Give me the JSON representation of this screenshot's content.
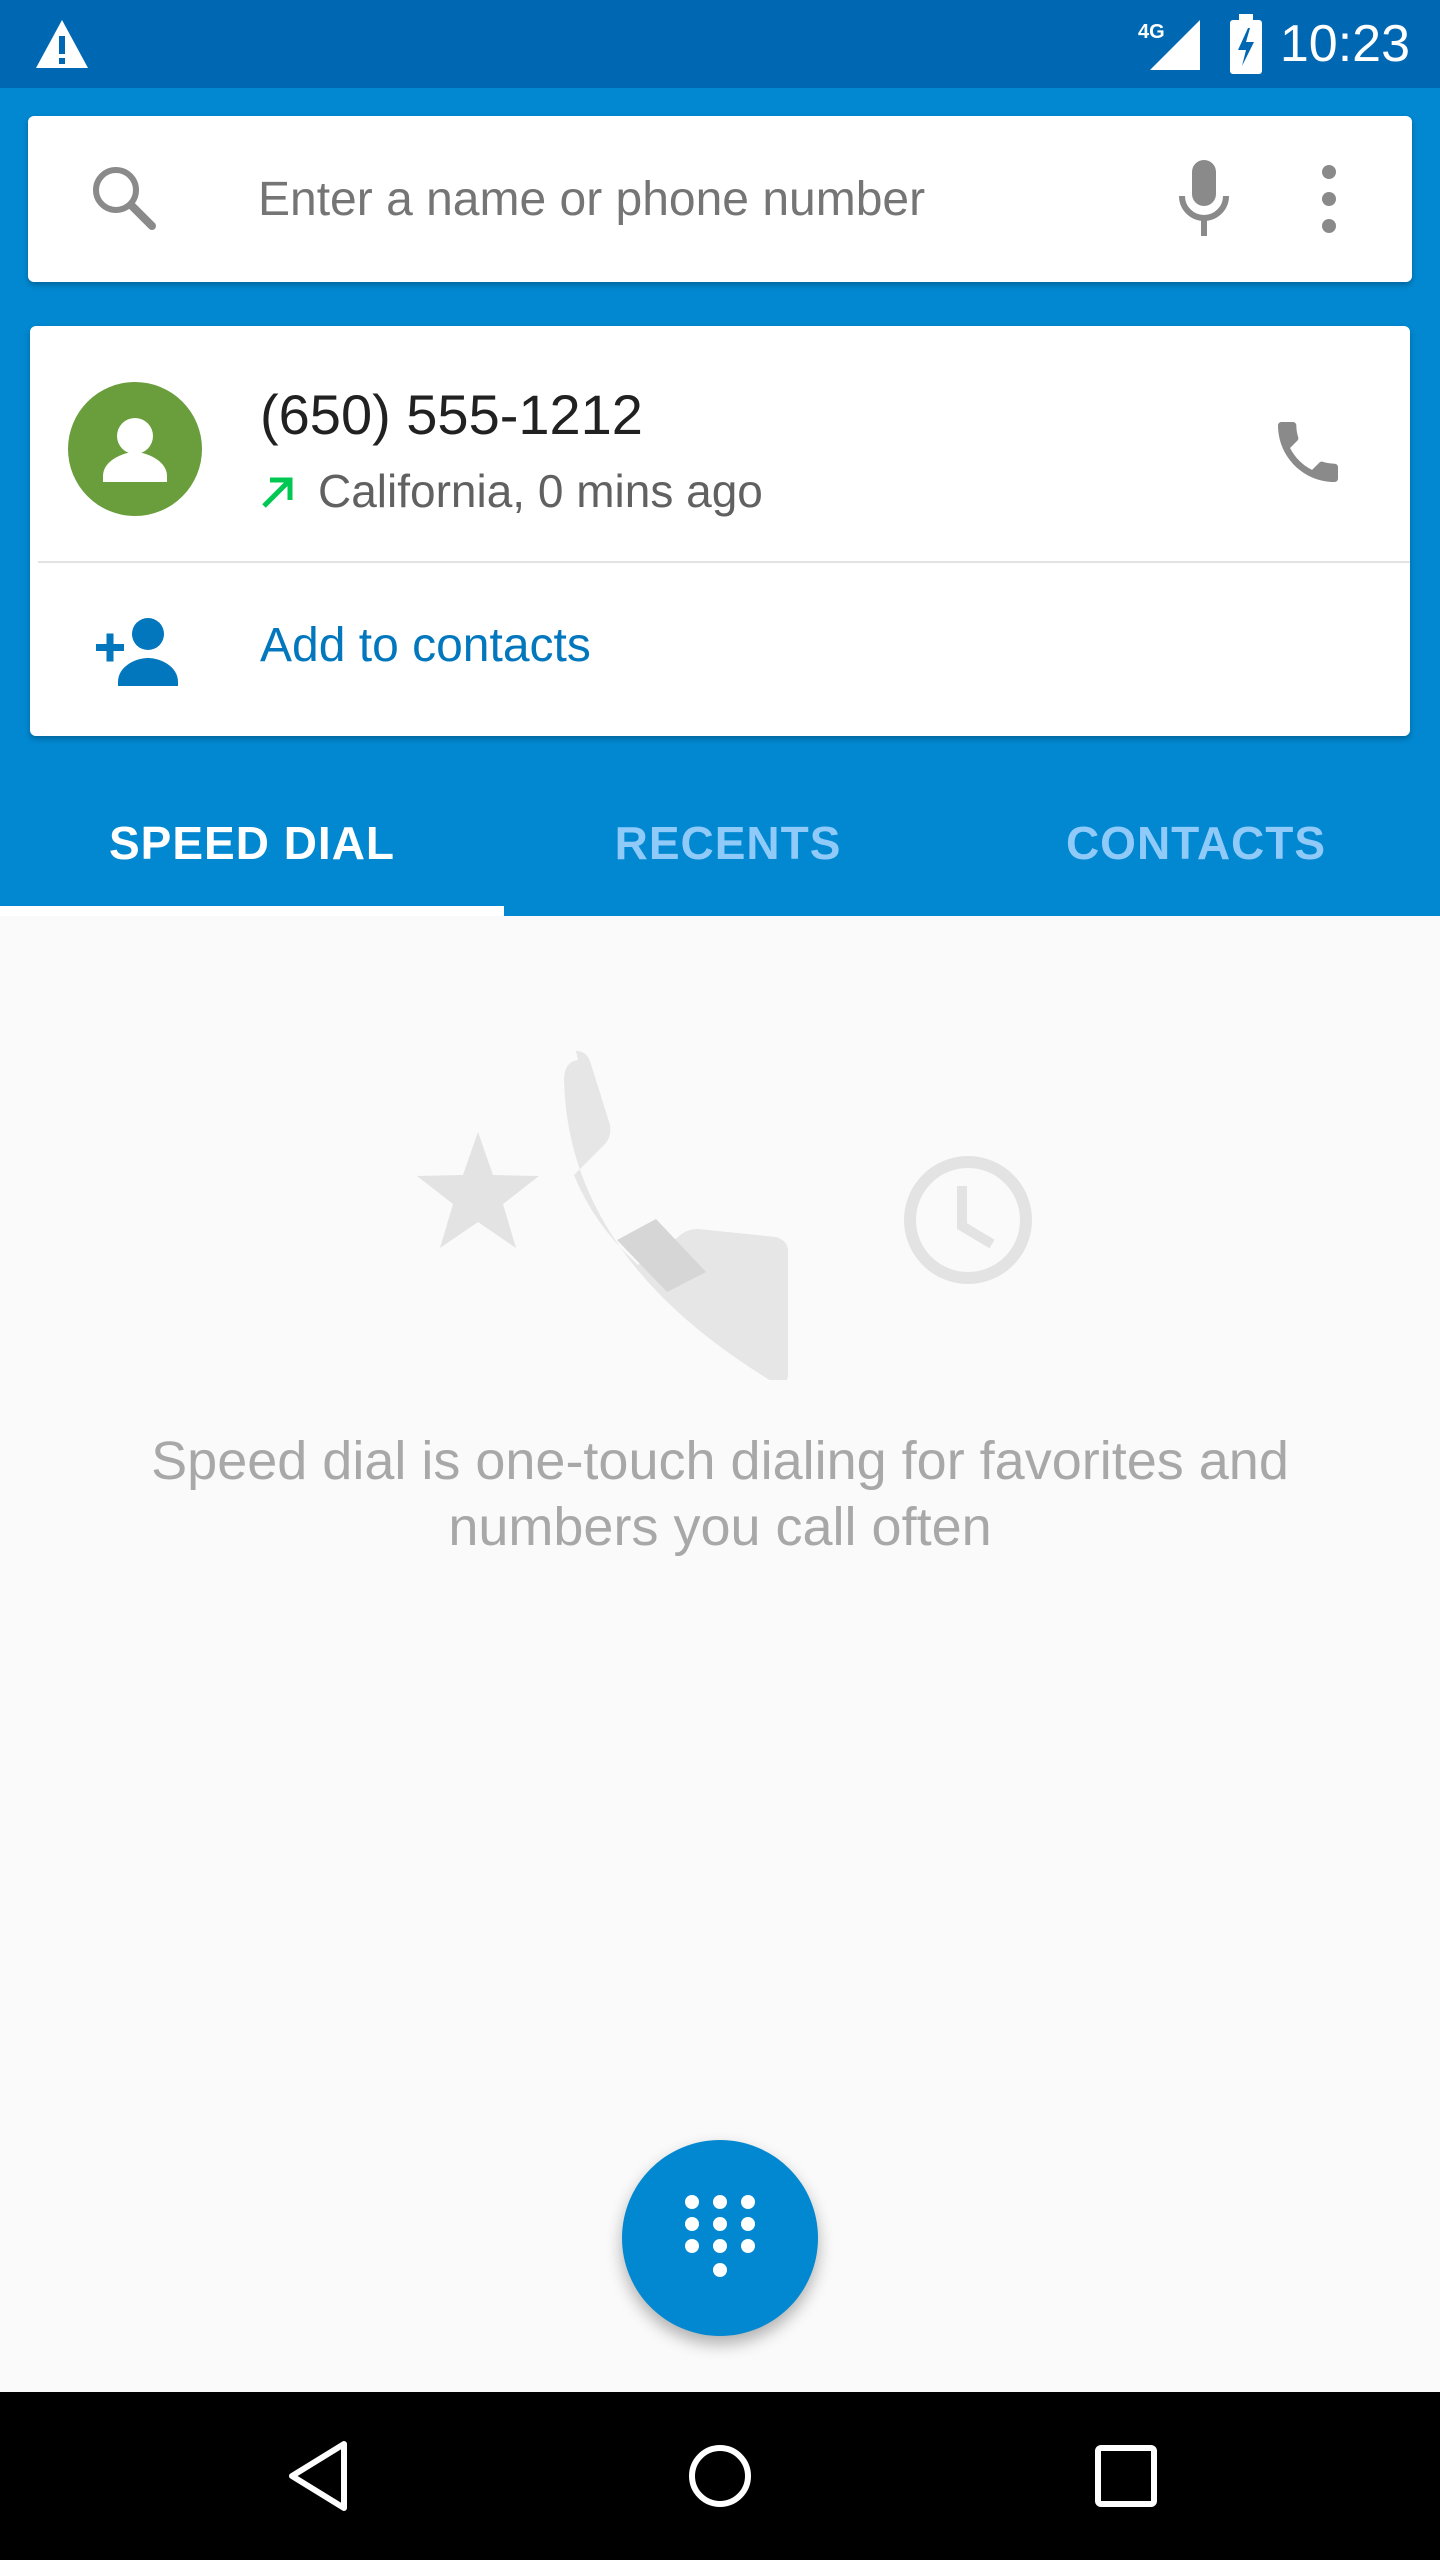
{
  "status_bar": {
    "time": "10:23",
    "network": "4G",
    "icons": [
      "warning-icon",
      "signal-icon",
      "battery-charging-icon"
    ]
  },
  "search": {
    "placeholder": "Enter a name or phone number",
    "value": "",
    "icons": [
      "search-icon",
      "mic-icon",
      "more-vert-icon"
    ]
  },
  "recent_call": {
    "number": "(650) 555-1212",
    "meta": "California, 0 mins ago",
    "call_type": "outgoing",
    "add_to_contacts": "Add to contacts",
    "icons": [
      "avatar-person-icon",
      "outgoing-call-icon",
      "call-icon",
      "add-person-icon"
    ]
  },
  "tabs": [
    {
      "label": "SPEED DIAL",
      "selected": true
    },
    {
      "label": "RECENTS",
      "selected": false
    },
    {
      "label": "CONTACTS",
      "selected": false
    }
  ],
  "speed_dial": {
    "empty_message": "Speed dial is one-touch dialing for favorites and numbers you call often"
  },
  "fab": {
    "icon": "dialpad-icon"
  },
  "nav_bar": {
    "icons": [
      "back-icon",
      "home-icon",
      "recents-icon"
    ]
  },
  "colors": {
    "primary": "#0288d1",
    "primary_dark": "#0068b3",
    "accent_text": "#0277bd",
    "avatar": "#6a9e3c",
    "outgoing_arrow": "#00c853"
  }
}
